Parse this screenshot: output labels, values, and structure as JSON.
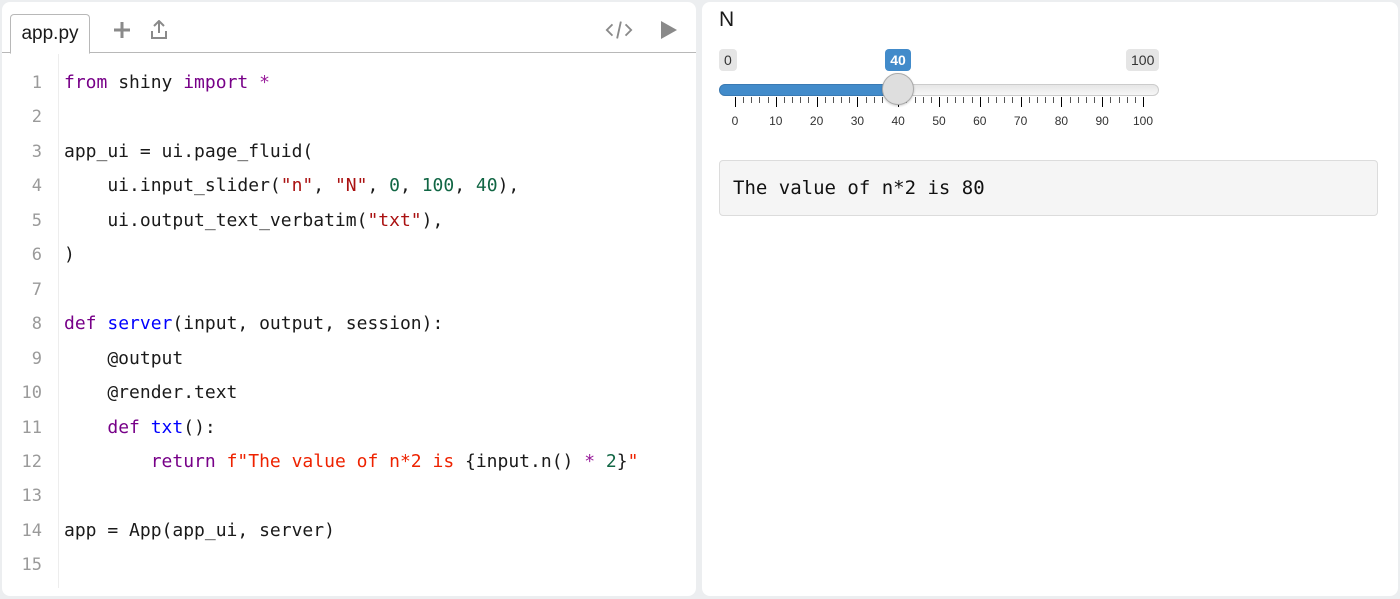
{
  "editor": {
    "tab_label": "app.py",
    "toolbar": {
      "add_icon": "plus-icon",
      "upload_icon": "upload-icon",
      "code_icon": "code-icon",
      "run_icon": "play-icon"
    },
    "lines": [
      {
        "n": "1",
        "tokens": [
          {
            "t": "from",
            "c": "kw"
          },
          {
            "t": " shiny ",
            "c": ""
          },
          {
            "t": "import",
            "c": "kw"
          },
          {
            "t": " ",
            "c": ""
          },
          {
            "t": "*",
            "c": "op"
          }
        ]
      },
      {
        "n": "2",
        "tokens": []
      },
      {
        "n": "3",
        "tokens": [
          {
            "t": "app_ui = ui.page_fluid(",
            "c": ""
          }
        ]
      },
      {
        "n": "4",
        "tokens": [
          {
            "t": "    ui.input_slider(",
            "c": ""
          },
          {
            "t": "\"n\"",
            "c": "str"
          },
          {
            "t": ", ",
            "c": ""
          },
          {
            "t": "\"N\"",
            "c": "str"
          },
          {
            "t": ", ",
            "c": ""
          },
          {
            "t": "0",
            "c": "num"
          },
          {
            "t": ", ",
            "c": ""
          },
          {
            "t": "100",
            "c": "num"
          },
          {
            "t": ", ",
            "c": ""
          },
          {
            "t": "40",
            "c": "num"
          },
          {
            "t": "),",
            "c": ""
          }
        ]
      },
      {
        "n": "5",
        "tokens": [
          {
            "t": "    ui.output_text_verbatim(",
            "c": ""
          },
          {
            "t": "\"txt\"",
            "c": "str"
          },
          {
            "t": "),",
            "c": ""
          }
        ]
      },
      {
        "n": "6",
        "tokens": [
          {
            "t": ")",
            "c": ""
          }
        ]
      },
      {
        "n": "7",
        "tokens": []
      },
      {
        "n": "8",
        "tokens": [
          {
            "t": "def",
            "c": "kw"
          },
          {
            "t": " ",
            "c": ""
          },
          {
            "t": "server",
            "c": "def"
          },
          {
            "t": "(input, output, session):",
            "c": ""
          }
        ]
      },
      {
        "n": "9",
        "tokens": [
          {
            "t": "    @output",
            "c": ""
          }
        ]
      },
      {
        "n": "10",
        "tokens": [
          {
            "t": "    @render.text",
            "c": ""
          }
        ]
      },
      {
        "n": "11",
        "tokens": [
          {
            "t": "    ",
            "c": ""
          },
          {
            "t": "def",
            "c": "kw"
          },
          {
            "t": " ",
            "c": ""
          },
          {
            "t": "txt",
            "c": "def"
          },
          {
            "t": "():",
            "c": ""
          }
        ]
      },
      {
        "n": "12",
        "tokens": [
          {
            "t": "        ",
            "c": ""
          },
          {
            "t": "return",
            "c": "kw"
          },
          {
            "t": " ",
            "c": ""
          },
          {
            "t": "f\"The value of n*2 is ",
            "c": "fstr"
          },
          {
            "t": "{input.n() ",
            "c": ""
          },
          {
            "t": "*",
            "c": "op"
          },
          {
            "t": " ",
            "c": ""
          },
          {
            "t": "2",
            "c": "num"
          },
          {
            "t": "}",
            "c": ""
          },
          {
            "t": "\"",
            "c": "fstr"
          }
        ]
      },
      {
        "n": "13",
        "tokens": []
      },
      {
        "n": "14",
        "tokens": [
          {
            "t": "app = App(app_ui, server)",
            "c": ""
          }
        ]
      },
      {
        "n": "15",
        "tokens": []
      }
    ]
  },
  "preview": {
    "slider": {
      "label": "N",
      "min": 0,
      "max": 100,
      "value": 40,
      "min_label": "0",
      "max_label": "100",
      "value_label": "40",
      "accent": "#428bca",
      "tick_labels": [
        "0",
        "10",
        "20",
        "30",
        "40",
        "50",
        "60",
        "70",
        "80",
        "90",
        "100"
      ]
    },
    "output_text": "The value of n*2 is 80"
  }
}
